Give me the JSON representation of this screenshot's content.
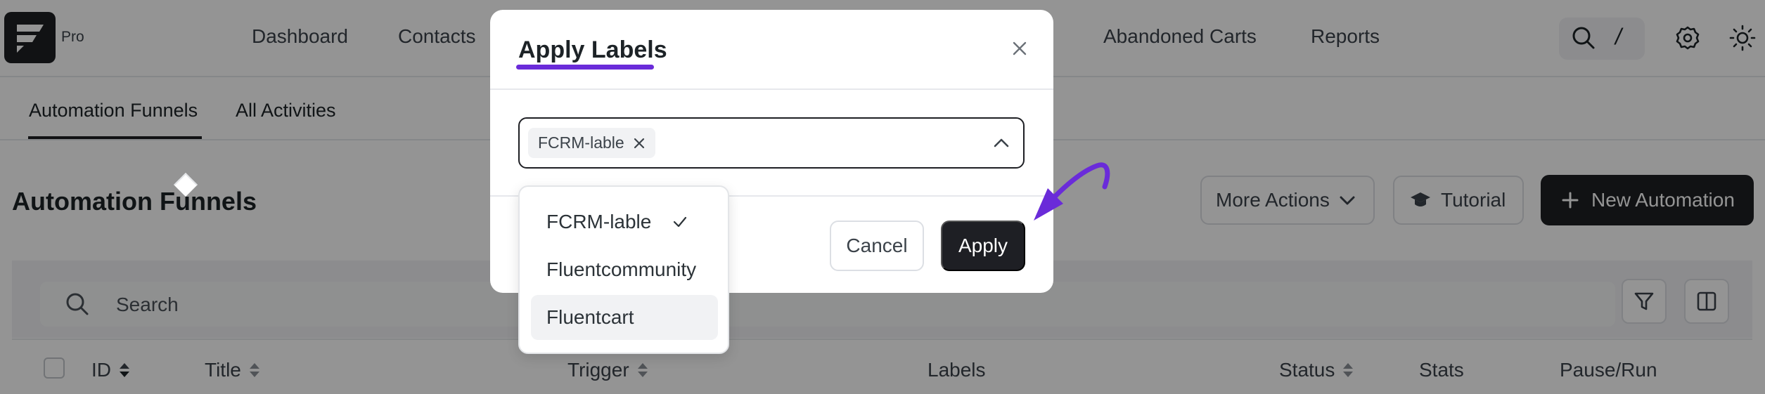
{
  "header": {
    "pro_badge": "Pro",
    "nav": [
      "Dashboard",
      "Contacts",
      "Abandoned Carts",
      "Reports"
    ],
    "tools": [
      "search-icon",
      "slash-shortcut",
      "gear-icon",
      "sun-icon"
    ],
    "shortcut_key": "/"
  },
  "subnav": {
    "tabs": [
      "Automation Funnels",
      "All Activities"
    ],
    "active": "Automation Funnels"
  },
  "page": {
    "title": "Automation Funnels",
    "more_actions": "More Actions",
    "tutorial": "Tutorial",
    "new_automation": "New Automation"
  },
  "search": {
    "placeholder": "Search"
  },
  "table": {
    "columns": [
      "ID",
      "Title",
      "Trigger",
      "Labels",
      "Status",
      "Stats",
      "Pause/Run"
    ]
  },
  "modal": {
    "title": "Apply Labels",
    "selected_tag": "FCRM-lable",
    "cancel": "Cancel",
    "apply": "Apply",
    "options": [
      {
        "label": "FCRM-lable",
        "selected": true
      },
      {
        "label": "Fluentcommunity",
        "selected": false
      },
      {
        "label": "Fluentcart",
        "selected": false
      }
    ]
  },
  "colors": {
    "dark": "#1e1f24",
    "accent_annotation": "#6a2bd9",
    "overlay": "rgba(0,0,0,0.42)"
  }
}
